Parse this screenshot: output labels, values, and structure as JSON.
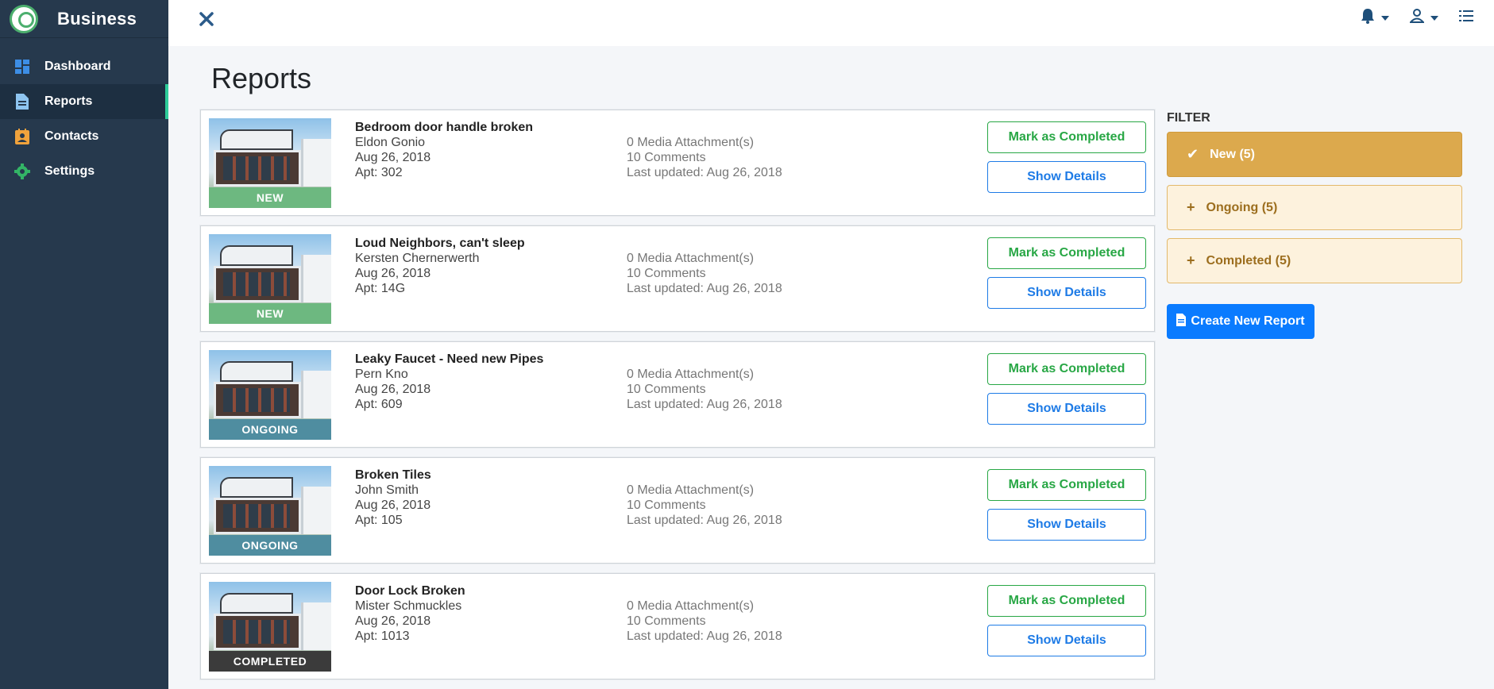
{
  "sidebar": {
    "brand": "Business",
    "items": [
      {
        "label": "Dashboard",
        "icon": "dashboard-icon",
        "active": false
      },
      {
        "label": "Reports",
        "icon": "document-icon",
        "active": true
      },
      {
        "label": "Contacts",
        "icon": "contacts-icon",
        "active": false
      },
      {
        "label": "Settings",
        "icon": "gear-icon",
        "active": false
      }
    ]
  },
  "header": {
    "close_icon": "close-icon",
    "icons": [
      "bell-icon",
      "user-icon",
      "list-icon"
    ]
  },
  "main": {
    "title": "Reports"
  },
  "reports": [
    {
      "title": "Bedroom door handle broken",
      "name": "Eldon Gonio",
      "date": "Aug 26, 2018",
      "apt": "Apt: 302",
      "status": "NEW",
      "media": "0 Media Attachment(s)",
      "comments": "10 Comments",
      "updated": "Last updated: Aug 26, 2018",
      "complete_label": "Mark as Completed",
      "details_label": "Show Details"
    },
    {
      "title": "Loud Neighbors, can't sleep",
      "name": "Kersten Chernerwerth",
      "date": "Aug 26, 2018",
      "apt": "Apt: 14G",
      "status": "NEW",
      "media": "0 Media Attachment(s)",
      "comments": "10 Comments",
      "updated": "Last updated: Aug 26, 2018",
      "complete_label": "Mark as Completed",
      "details_label": "Show Details"
    },
    {
      "title": "Leaky Faucet - Need new Pipes",
      "name": "Pern Kno",
      "date": "Aug 26, 2018",
      "apt": "Apt: 609",
      "status": "ONGOING",
      "media": "0 Media Attachment(s)",
      "comments": "10 Comments",
      "updated": "Last updated: Aug 26, 2018",
      "complete_label": "Mark as Completed",
      "details_label": "Show Details"
    },
    {
      "title": "Broken Tiles",
      "name": "John Smith",
      "date": "Aug 26, 2018",
      "apt": "Apt: 105",
      "status": "ONGOING",
      "media": "0 Media Attachment(s)",
      "comments": "10 Comments",
      "updated": "Last updated: Aug 26, 2018",
      "complete_label": "Mark as Completed",
      "details_label": "Show Details"
    },
    {
      "title": "Door Lock Broken",
      "name": "Mister Schmuckles",
      "date": "Aug 26, 2018",
      "apt": "Apt: 1013",
      "status": "COMPLETED",
      "media": "0 Media Attachment(s)",
      "comments": "10 Comments",
      "updated": "Last updated: Aug 26, 2018",
      "complete_label": "Mark as Completed",
      "details_label": "Show Details"
    }
  ],
  "status_colors": {
    "NEW": "#6db880",
    "ONGOING": "#4f8da0",
    "COMPLETED": "#3b3b3b"
  },
  "filter": {
    "label": "FILTER",
    "items": [
      {
        "label": "New (5)",
        "active": true,
        "symbol": "✔"
      },
      {
        "label": "Ongoing (5)",
        "active": false,
        "symbol": "+"
      },
      {
        "label": "Completed (5)",
        "active": false,
        "symbol": "+"
      }
    ],
    "create_label": "Create New Report"
  },
  "colors": {
    "sidebar_bg": "#26394d",
    "accent_green": "#28a745",
    "accent_blue": "#1e7be6",
    "filter_active": "#dca94d",
    "filter_inactive": "#fdf2dd",
    "create_button": "#0a7bff"
  }
}
